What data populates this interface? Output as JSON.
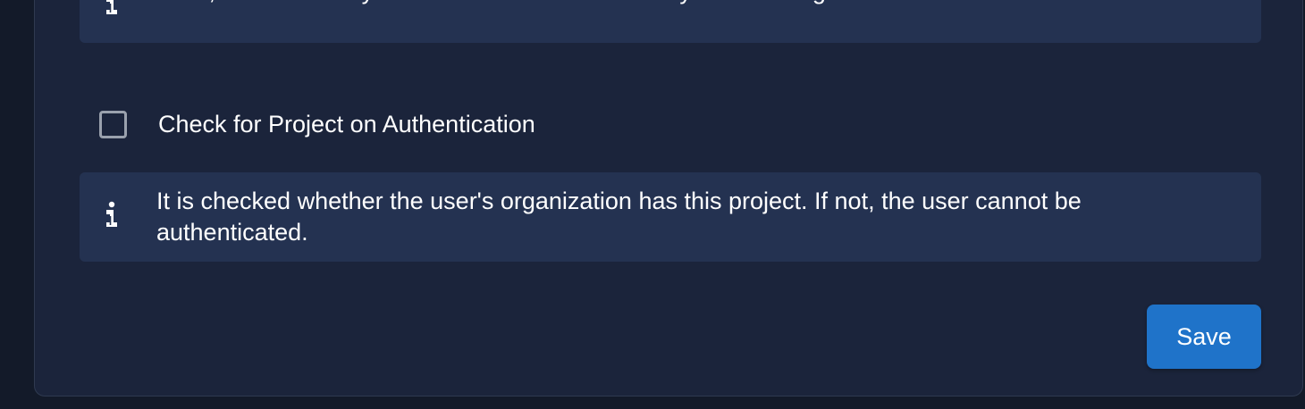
{
  "role_required": {
    "hint": "If set, users are only allowed to authenticate if any role is assigned to their account."
  },
  "project_check": {
    "label": "Check for Project on Authentication",
    "checked": false,
    "hint": "It is checked whether the user's organization has this project. If not, the user cannot be authenticated."
  },
  "actions": {
    "save_label": "Save"
  },
  "colors": {
    "background": "#131a29",
    "card": "#1b243b",
    "info_box": "#243251",
    "primary": "#1f73c9",
    "text": "#ffffff"
  },
  "icons": {
    "info": "info-icon"
  }
}
